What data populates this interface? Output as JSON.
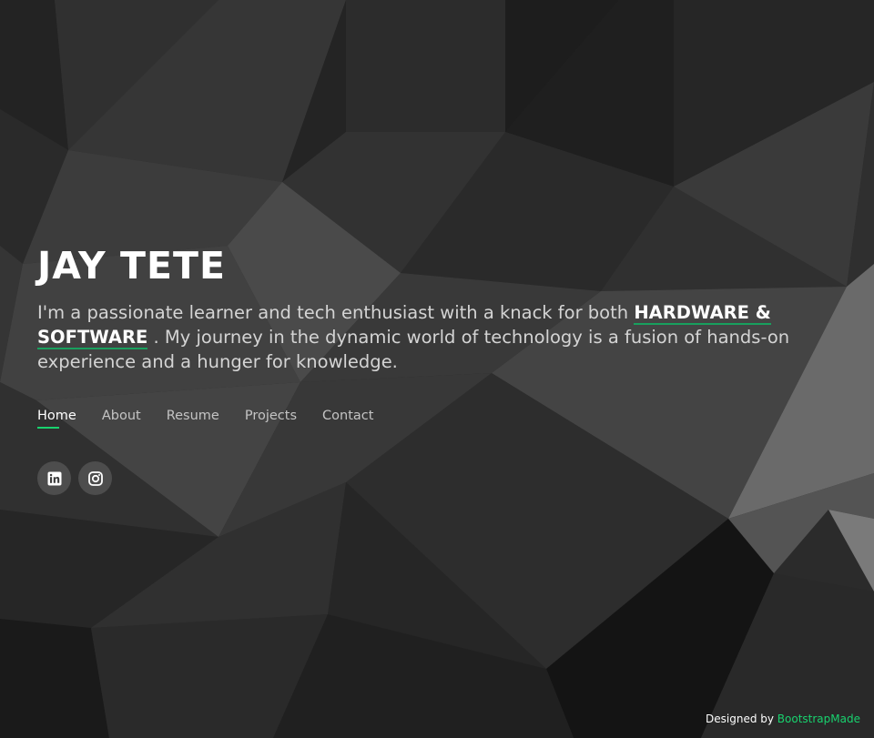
{
  "hero": {
    "name": "JAY TETE",
    "tagline_before": "I'm a passionate learner and tech enthusiast with a knack for both ",
    "tagline_highlight": "HARDWARE & SOFTWARE",
    "tagline_after": " . My journey in the dynamic world of technology is a fusion of hands-on experience and a hunger for knowledge."
  },
  "nav": {
    "items": [
      {
        "label": "Home",
        "active": true
      },
      {
        "label": "About"
      },
      {
        "label": "Resume"
      },
      {
        "label": "Projects"
      },
      {
        "label": "Contact"
      }
    ]
  },
  "social": {
    "items": [
      {
        "icon": "linkedin-icon"
      },
      {
        "icon": "instagram-icon"
      }
    ]
  },
  "footer": {
    "credit_prefix": "Designed by ",
    "credit_link": "BootstrapMade"
  },
  "colors": {
    "accent": "#18d26e",
    "text": "#ffffff",
    "background": "#262626"
  }
}
